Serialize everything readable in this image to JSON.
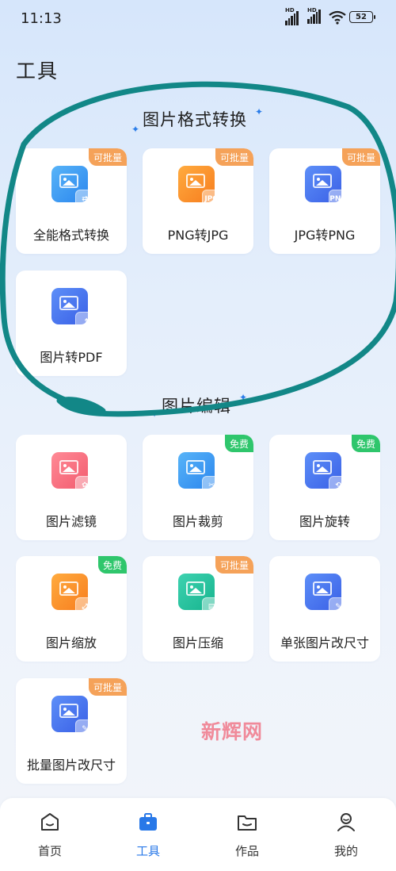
{
  "status": {
    "time": "11:13",
    "battery": "52",
    "signal1": "HD",
    "signal2": "HD"
  },
  "page_title": "工具",
  "sections": [
    {
      "title": "图片格式转换"
    },
    {
      "title": "图片编辑"
    }
  ],
  "cards": [
    {
      "label": "全能格式转换",
      "badge": "可批量",
      "icon": "format-convert-icon",
      "sub": ""
    },
    {
      "label": "PNG转JPG",
      "badge": "可批量",
      "icon": "png-to-jpg-icon",
      "sub": "JPG"
    },
    {
      "label": "JPG转PNG",
      "badge": "可批量",
      "icon": "jpg-to-png-icon",
      "sub": "PNG"
    },
    {
      "label": "图片转PDF",
      "badge": "",
      "icon": "image-to-pdf-icon",
      "sub": ""
    },
    {
      "label": "图片滤镜",
      "badge": "",
      "icon": "filter-icon",
      "sub": ""
    },
    {
      "label": "图片裁剪",
      "badge": "免费",
      "icon": "crop-icon",
      "sub": ""
    },
    {
      "label": "图片旋转",
      "badge": "免费",
      "icon": "rotate-icon",
      "sub": ""
    },
    {
      "label": "图片缩放",
      "badge": "免费",
      "icon": "zoom-icon",
      "sub": ""
    },
    {
      "label": "图片压缩",
      "badge": "可批量",
      "icon": "compress-icon",
      "sub": ""
    },
    {
      "label": "单张图片改尺寸",
      "badge": "",
      "icon": "resize-icon",
      "sub": ""
    },
    {
      "label": "批量图片改尺寸",
      "badge": "可批量",
      "icon": "batch-resize-icon",
      "sub": ""
    }
  ],
  "watermark": "新辉网",
  "nav": [
    {
      "label": "首页",
      "icon": "home-icon"
    },
    {
      "label": "工具",
      "icon": "toolbox-icon"
    },
    {
      "label": "作品",
      "icon": "folder-icon"
    },
    {
      "label": "我的",
      "icon": "user-icon"
    }
  ],
  "colors": {
    "accent": "#2878e8",
    "batch_badge": "#f5a259",
    "free_badge": "#2fc66c",
    "annotation": "#128787"
  }
}
